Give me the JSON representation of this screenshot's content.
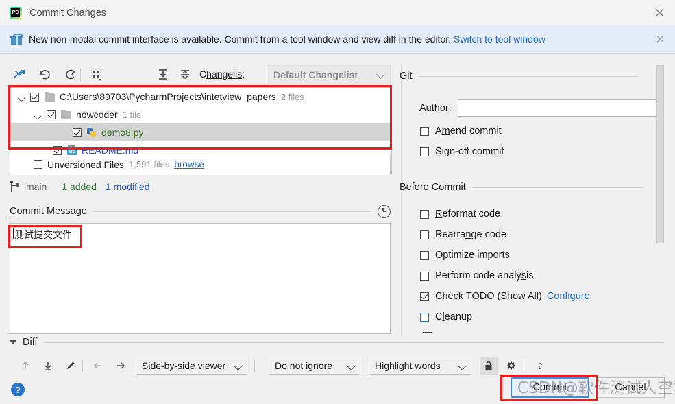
{
  "window": {
    "title": "Commit Changes",
    "app_icon": "pycharm-logo-icon",
    "close_icon": "close-icon"
  },
  "notification": {
    "icon": "gift-icon",
    "text": "New non-modal commit interface is available. Commit from a tool window and view diff in the editor.",
    "link": "Switch to tool window",
    "close_icon": "close-icon"
  },
  "toolbar": {
    "icons": [
      {
        "name": "collapse-changes-icon"
      },
      {
        "name": "rollback-icon"
      },
      {
        "name": "refresh-icon"
      },
      {
        "name": "group-by-icon"
      },
      {
        "name": "expand-all-icon"
      },
      {
        "name": "collapse-all-icon"
      }
    ],
    "changelist_label": "Changelist:",
    "changelist_label_pre": "C",
    "changelist_label_mid": "hangelis",
    "changelist_label_post": ":",
    "changelist_value": "Default Changelist"
  },
  "changes_tree": {
    "rows": [
      {
        "label": "C:\\Users\\89703\\PycharmProjects\\intetview_papers",
        "count": "2 files",
        "icon": "folder-icon",
        "checked": true,
        "expanded": true,
        "indent": 0,
        "color": "default",
        "selected": false
      },
      {
        "label": "nowcoder",
        "count": "1 file",
        "icon": "folder-icon",
        "checked": true,
        "expanded": true,
        "indent": 1,
        "color": "default",
        "selected": false
      },
      {
        "label": "demo8.py",
        "count": "",
        "icon": "python-file-icon",
        "checked": true,
        "expanded": false,
        "indent": 2,
        "color": "green",
        "selected": true
      },
      {
        "label": "README.md",
        "count": "",
        "icon": "markdown-file-icon",
        "checked": true,
        "expanded": false,
        "indent": 2,
        "color": "blue",
        "selected": false
      }
    ],
    "unversioned": {
      "label": "Unversioned Files",
      "count": "1,591 files",
      "browse": "browse",
      "checked": false
    }
  },
  "status_bar": {
    "branch_icon": "branch-icon",
    "branch": "main",
    "added": "1 added",
    "modified": "1 modified"
  },
  "commit_message": {
    "title": "Commit Message",
    "title_pre": "C",
    "title_post": "ommit Message",
    "history_icon": "clock-icon",
    "value": "测试提交文件"
  },
  "git_panel": {
    "section_title": "Git",
    "author_label": "Author:",
    "author_label_pre": "A",
    "author_label_post": "uthor:",
    "author_value": "",
    "options": [
      {
        "label": "Amend commit",
        "pre": "A",
        "mnemonic": "m",
        "post": "end commit",
        "checked": false,
        "focused": false
      },
      {
        "label": "Sign-off commit",
        "pre": "Sign-off commit",
        "mnemonic": "",
        "post": "",
        "checked": false,
        "focused": false
      }
    ]
  },
  "before_commit": {
    "section_title": "Before Commit",
    "options": [
      {
        "label": "Reformat code",
        "pre": "",
        "mnemonic": "R",
        "post": "eformat code",
        "checked": false,
        "focused": false,
        "link": ""
      },
      {
        "label": "Rearrange code",
        "pre": "Rearra",
        "mnemonic": "n",
        "post": "ge code",
        "checked": false,
        "focused": false,
        "link": ""
      },
      {
        "label": "Optimize imports",
        "pre": "",
        "mnemonic": "O",
        "post": "ptimize imports",
        "checked": false,
        "focused": false,
        "link": ""
      },
      {
        "label": "Perform code analysis",
        "pre": "Perform code analy",
        "mnemonic": "s",
        "post": "is",
        "checked": false,
        "focused": false,
        "link": ""
      },
      {
        "label": "Check TODO (Show All)",
        "pre": "Check TODO (Show All)",
        "mnemonic": "",
        "post": "",
        "checked": true,
        "focused": false,
        "link": "Configure"
      },
      {
        "label": "Cleanup",
        "pre": "C",
        "mnemonic": "l",
        "post": "eanup",
        "checked": false,
        "focused": true,
        "link": ""
      }
    ]
  },
  "diff": {
    "section_title": "Diff",
    "expanded": true,
    "icons": [
      {
        "name": "previous-difference-icon"
      },
      {
        "name": "next-difference-icon"
      },
      {
        "name": "edit-source-icon"
      },
      {
        "name": "apply-left-icon"
      },
      {
        "name": "apply-right-icon"
      },
      {
        "name": "lock-icon"
      },
      {
        "name": "settings-icon"
      },
      {
        "name": "help-icon"
      }
    ],
    "viewer_mode": "Side-by-side viewer",
    "whitespace_mode": "Do not ignore",
    "highlight_mode": "Highlight words"
  },
  "footer": {
    "help_icon": "help-icon",
    "help_glyph": "?",
    "commit_button": "Commit",
    "cancel_button": "Cancel"
  },
  "watermark": {
    "text": "CSDN@软件测试人空翼"
  },
  "annotations": [
    {
      "name": "changes-tree-highlight"
    },
    {
      "name": "commit-message-highlight"
    },
    {
      "name": "commit-button-highlight"
    }
  ]
}
